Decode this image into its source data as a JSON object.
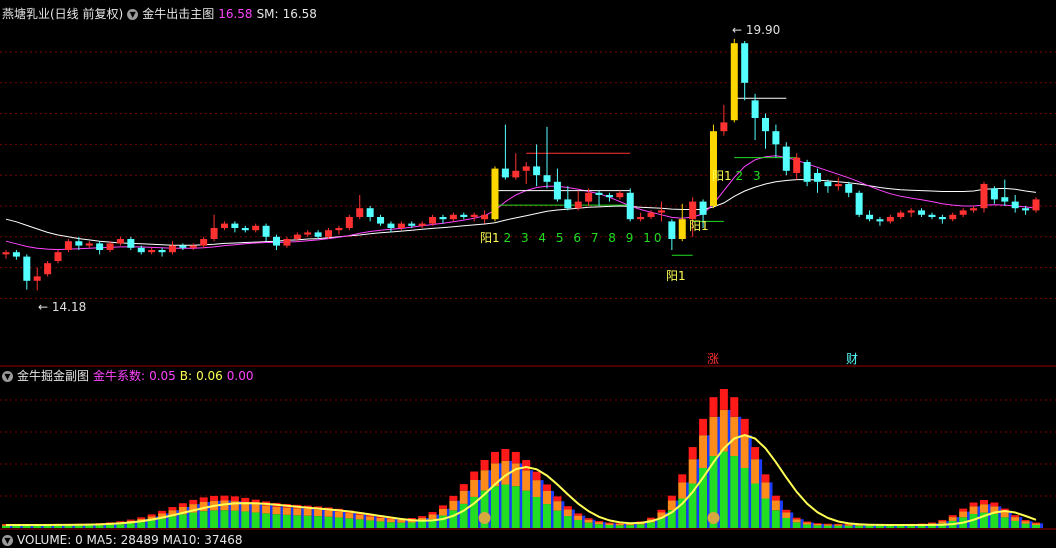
{
  "main_header": {
    "stock": "燕塘乳业(日线 前复权)",
    "indicator": "金牛出击主图",
    "value1": "16.58",
    "sm_label": "SM:",
    "sm_value": "16.58"
  },
  "sub_header": {
    "indicator": "金牛掘金副图",
    "coef_label": "金牛系数:",
    "coef_value": "0.05",
    "b_label": "B:",
    "b_value": "0.06",
    "extra_value": "0.00"
  },
  "vol_header": {
    "text": "VOLUME: 0  MA5: 28489  MA10: 37468"
  },
  "labels": {
    "high": "19.90",
    "low": "14.18",
    "seq_a_prefix": "阳1",
    "seq_a_nums": [
      "2",
      "3",
      "4",
      "5",
      "6",
      "7",
      "8",
      "9",
      "10"
    ],
    "seq_b": "阳1",
    "seq_c": "阳1",
    "seq_d": "阳1",
    "seq_e_prefix": "阳1",
    "seq_e_nums": [
      "2",
      "3"
    ],
    "event_zhang": "涨",
    "event_cai": "财"
  },
  "colors": {
    "up": "#ff3232",
    "down": "#54ffff",
    "signal": "#ffd700",
    "ma_white": "#ffffff",
    "ma_magenta": "#ff44ff",
    "grid": "#7a0000",
    "green_mark": "#22dd22"
  },
  "chart_data": {
    "type": "candlestick",
    "candles": [
      [
        15.0,
        15.05,
        14.9,
        15.1
      ],
      [
        15.05,
        14.95,
        14.88,
        15.1
      ],
      [
        14.95,
        14.4,
        14.2,
        15.0
      ],
      [
        14.4,
        14.5,
        14.18,
        14.7
      ],
      [
        14.55,
        14.8,
        14.5,
        14.85
      ],
      [
        14.85,
        15.05,
        14.8,
        15.1
      ],
      [
        15.1,
        15.3,
        15.05,
        15.35
      ],
      [
        15.3,
        15.2,
        15.1,
        15.4
      ],
      [
        15.2,
        15.25,
        15.15,
        15.3
      ],
      [
        15.25,
        15.1,
        15.0,
        15.3
      ],
      [
        15.1,
        15.25,
        15.05,
        15.3
      ],
      [
        15.25,
        15.35,
        15.2,
        15.4
      ],
      [
        15.35,
        15.15,
        15.1,
        15.4
      ],
      [
        15.15,
        15.05,
        15.0,
        15.2
      ],
      [
        15.05,
        15.1,
        15.0,
        15.15
      ],
      [
        15.1,
        15.05,
        14.95,
        15.15
      ],
      [
        15.05,
        15.2,
        15.0,
        15.3
      ],
      [
        15.2,
        15.15,
        15.1,
        15.25
      ],
      [
        15.15,
        15.2,
        15.1,
        15.25
      ],
      [
        15.2,
        15.35,
        15.15,
        15.4
      ],
      [
        15.35,
        15.6,
        15.3,
        15.9
      ],
      [
        15.6,
        15.7,
        15.55,
        15.75
      ],
      [
        15.7,
        15.6,
        15.5,
        15.75
      ],
      [
        15.6,
        15.55,
        15.5,
        15.65
      ],
      [
        15.55,
        15.65,
        15.5,
        15.7
      ],
      [
        15.65,
        15.4,
        15.3,
        15.7
      ],
      [
        15.4,
        15.2,
        15.1,
        15.45
      ],
      [
        15.2,
        15.35,
        15.15,
        15.4
      ],
      [
        15.35,
        15.45,
        15.3,
        15.5
      ],
      [
        15.45,
        15.5,
        15.4,
        15.55
      ],
      [
        15.5,
        15.4,
        15.35,
        15.55
      ],
      [
        15.4,
        15.55,
        15.35,
        15.6
      ],
      [
        15.55,
        15.6,
        15.45,
        15.65
      ],
      [
        15.6,
        15.85,
        15.55,
        15.9
      ],
      [
        15.85,
        16.05,
        15.8,
        16.35
      ],
      [
        16.05,
        15.85,
        15.75,
        16.1
      ],
      [
        15.85,
        15.7,
        15.65,
        15.9
      ],
      [
        15.7,
        15.6,
        15.5,
        15.75
      ],
      [
        15.6,
        15.7,
        15.55,
        15.75
      ],
      [
        15.7,
        15.65,
        15.6,
        15.75
      ],
      [
        15.65,
        15.7,
        15.6,
        15.75
      ],
      [
        15.7,
        15.85,
        15.65,
        15.9
      ],
      [
        15.85,
        15.8,
        15.7,
        15.9
      ],
      [
        15.8,
        15.9,
        15.75,
        15.95
      ],
      [
        15.9,
        15.85,
        15.8,
        15.95
      ],
      [
        15.85,
        15.9,
        15.75,
        15.95
      ],
      [
        15.8,
        15.9,
        15.7,
        16.0
      ],
      [
        15.8,
        16.95,
        15.75,
        17.0
      ],
      [
        16.95,
        16.75,
        16.7,
        17.95
      ],
      [
        16.75,
        16.9,
        16.7,
        17.3
      ],
      [
        16.9,
        17.0,
        16.6,
        17.1
      ],
      [
        17.0,
        16.8,
        16.55,
        17.5
      ],
      [
        16.8,
        16.65,
        16.5,
        17.9
      ],
      [
        16.65,
        16.25,
        16.2,
        16.95
      ],
      [
        16.25,
        16.05,
        16.0,
        16.55
      ],
      [
        16.05,
        16.2,
        16.0,
        16.45
      ],
      [
        16.2,
        16.4,
        16.1,
        16.5
      ],
      [
        16.4,
        16.35,
        16.1,
        16.45
      ],
      [
        16.35,
        16.3,
        16.2,
        16.4
      ],
      [
        16.3,
        16.4,
        16.25,
        16.45
      ],
      [
        16.4,
        15.8,
        15.75,
        16.5
      ],
      [
        15.8,
        15.85,
        15.75,
        15.95
      ],
      [
        15.85,
        15.95,
        15.8,
        16.0
      ],
      [
        15.95,
        16.0,
        15.75,
        16.2
      ],
      [
        15.75,
        15.35,
        15.1,
        15.8
      ],
      [
        15.35,
        15.8,
        15.3,
        16.15
      ],
      [
        15.8,
        16.2,
        15.4,
        16.3
      ],
      [
        16.2,
        15.9,
        15.6,
        16.25
      ],
      [
        16.1,
        17.8,
        16.05,
        17.95
      ],
      [
        17.8,
        18.0,
        17.7,
        18.4
      ],
      [
        18.05,
        19.8,
        18.0,
        19.9
      ],
      [
        19.8,
        18.9,
        18.5,
        19.85
      ],
      [
        18.5,
        18.1,
        17.6,
        18.65
      ],
      [
        18.1,
        17.8,
        17.4,
        18.2
      ],
      [
        17.8,
        17.5,
        17.2,
        17.95
      ],
      [
        17.45,
        16.9,
        16.8,
        17.55
      ],
      [
        16.85,
        17.2,
        16.7,
        17.3
      ],
      [
        17.1,
        16.65,
        16.55,
        17.15
      ],
      [
        16.85,
        16.65,
        16.4,
        16.95
      ],
      [
        16.65,
        16.55,
        16.4,
        16.7
      ],
      [
        16.55,
        16.6,
        16.45,
        16.75
      ],
      [
        16.6,
        16.4,
        16.3,
        16.65
      ],
      [
        16.4,
        15.9,
        15.85,
        16.45
      ],
      [
        15.9,
        15.8,
        15.75,
        16.0
      ],
      [
        15.8,
        15.75,
        15.65,
        15.85
      ],
      [
        15.75,
        15.85,
        15.7,
        15.9
      ],
      [
        15.85,
        15.95,
        15.8,
        16.0
      ],
      [
        15.95,
        16.0,
        15.85,
        16.05
      ],
      [
        16.0,
        15.9,
        15.85,
        16.05
      ],
      [
        15.9,
        15.85,
        15.8,
        15.95
      ],
      [
        15.85,
        15.8,
        15.7,
        15.9
      ],
      [
        15.8,
        15.9,
        15.75,
        15.95
      ],
      [
        15.9,
        16.0,
        15.85,
        16.05
      ],
      [
        16.0,
        16.05,
        15.95,
        16.1
      ],
      [
        16.05,
        16.6,
        15.95,
        16.65
      ],
      [
        16.5,
        16.25,
        16.15,
        16.55
      ],
      [
        16.3,
        16.2,
        16.1,
        16.7
      ],
      [
        16.2,
        16.05,
        15.95,
        16.35
      ],
      [
        16.05,
        16.0,
        15.9,
        16.1
      ],
      [
        16.0,
        16.25,
        15.95,
        16.3
      ]
    ],
    "ma_white": [
      15.8,
      15.74,
      15.66,
      15.58,
      15.5,
      15.44,
      15.4,
      15.36,
      15.33,
      15.3,
      15.28,
      15.26,
      15.25,
      15.24,
      15.23,
      15.22,
      15.21,
      15.21,
      15.21,
      15.22,
      15.23,
      15.25,
      15.26,
      15.27,
      15.28,
      15.29,
      15.3,
      15.32,
      15.33,
      15.35,
      15.36,
      15.38,
      15.4,
      15.42,
      15.44,
      15.47,
      15.49,
      15.51,
      15.53,
      15.55,
      15.57,
      15.59,
      15.61,
      15.63,
      15.65,
      15.67,
      15.69,
      15.72,
      15.78,
      15.83,
      15.88,
      15.93,
      15.98,
      16.01,
      16.03,
      16.05,
      16.07,
      16.08,
      16.09,
      16.1,
      16.09,
      16.07,
      16.06,
      16.05,
      16.03,
      16.02,
      16.02,
      16.02,
      16.08,
      16.17,
      16.32,
      16.44,
      16.53,
      16.6,
      16.65,
      16.68,
      16.7,
      16.7,
      16.69,
      16.67,
      16.65,
      16.63,
      16.6,
      16.56,
      16.52,
      16.49,
      16.47,
      16.46,
      16.45,
      16.44,
      16.43,
      16.43,
      16.43,
      16.44,
      16.48,
      16.49,
      16.5,
      16.48,
      16.44,
      16.41
    ],
    "ma_magenta": [
      15.3,
      15.24,
      15.18,
      15.14,
      15.12,
      15.11,
      15.12,
      15.13,
      15.14,
      15.15,
      15.16,
      15.17,
      15.17,
      15.17,
      15.16,
      15.15,
      15.14,
      15.14,
      15.14,
      15.15,
      15.17,
      15.2,
      15.22,
      15.24,
      15.26,
      15.27,
      15.27,
      15.28,
      15.29,
      15.31,
      15.33,
      15.36,
      15.39,
      15.43,
      15.48,
      15.52,
      15.55,
      15.57,
      15.59,
      15.62,
      15.65,
      15.68,
      15.71,
      15.74,
      15.78,
      15.82,
      15.88,
      16.0,
      16.2,
      16.35,
      16.45,
      16.52,
      16.55,
      16.55,
      16.52,
      16.48,
      16.43,
      16.38,
      16.3,
      16.2,
      16.1,
      16.02,
      15.96,
      15.9,
      15.84,
      15.82,
      15.85,
      15.92,
      16.15,
      16.45,
      16.75,
      17.0,
      17.15,
      17.22,
      17.24,
      17.2,
      17.14,
      17.06,
      16.98,
      16.9,
      16.82,
      16.74,
      16.65,
      16.55,
      16.46,
      16.38,
      16.32,
      16.28,
      16.24,
      16.2,
      16.15,
      16.12,
      16.1,
      16.1,
      16.12,
      16.13,
      16.12,
      16.1,
      16.08,
      16.05
    ]
  }
}
